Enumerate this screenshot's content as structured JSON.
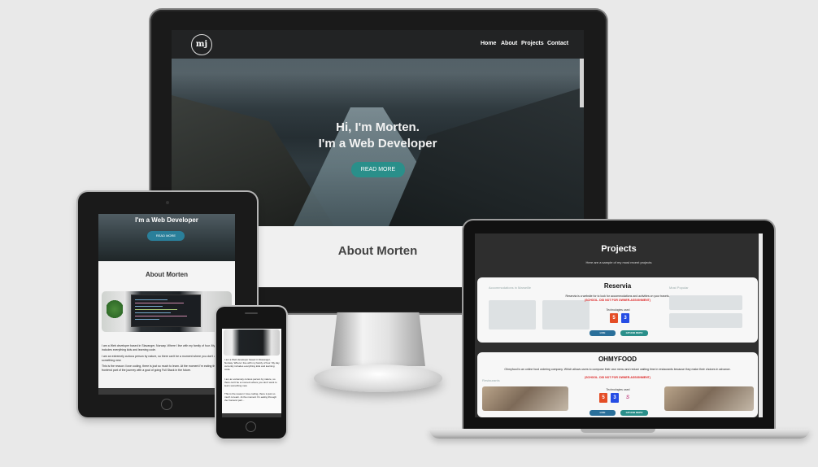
{
  "desktop": {
    "logo_text": "mj",
    "nav": [
      "Home",
      "About",
      "Projects",
      "Contact"
    ],
    "hero_line1": "Hi, I'm Morten.",
    "hero_line2": "I'm a Web Developer",
    "hero_button": "READ MORE",
    "about_title": "About Morten"
  },
  "tablet": {
    "hero_title": "I'm a Web Developer",
    "hero_button": "READ MORE",
    "about_title": "About Morten",
    "para1": "I am a Web developer based in Stavanger, Norway. Where I live with my family of four. My day currently includes everything kids and learning code.",
    "para2": "I am an extremely curious person by nature, so there can't be a moment where you don't want to learn something new.",
    "para3": "This is the reason I love coding, there is just so much to learn. At the moment I'm eating through the frontend part of the journey with a goal of going Full Stack in the future."
  },
  "phone": {
    "para1": "I am a Web developer based in Stavanger, Norway. Where I live with my family of four. My day currently includes everything kids and learning code.",
    "para2": "I am an extremely curious person by nature, so there can't be a moment where you don't want to learn something new.",
    "para3": "This is the reason I love coding, there is just so much to learn. At the moment I'm eating through the frontend part..."
  },
  "laptop": {
    "title": "Projects",
    "subtitle": "Here are a sample of my most recent projects",
    "projects": [
      {
        "name": "Reservia",
        "description": "Reservia is a website for to look for accommodations and activities on your travels.",
        "note": "(SCHOOL. DID NOT FOR OWNER-ASSIGNMENT)",
        "tech_label": "Technologies used",
        "live_label": "LIVE",
        "github_label": "GITHUB REPO",
        "bg_left": "Accommodations in Marseille",
        "bg_right": "Most Popular"
      },
      {
        "name": "OHMYFOOD",
        "description": "Ohmyfood is an online food ordering company. Which allows users to compose their own menu and reduce waiting time in restaurants because they make their choices in advance.",
        "note": "(SCHOOL. DID NOT FOR OWNER-ASSIGNMENT)",
        "tech_label": "Technologies used",
        "live_label": "LIVE",
        "github_label": "GITHUB REPO",
        "bg_left": "Restaurants"
      }
    ],
    "badges": [
      "5",
      "3"
    ]
  },
  "colors": {
    "teal": "#2a8f8a",
    "live_button": "#2a6f9a",
    "github_button": "#2a8f8a",
    "html5": "#e44d26",
    "css3": "#264de4"
  }
}
